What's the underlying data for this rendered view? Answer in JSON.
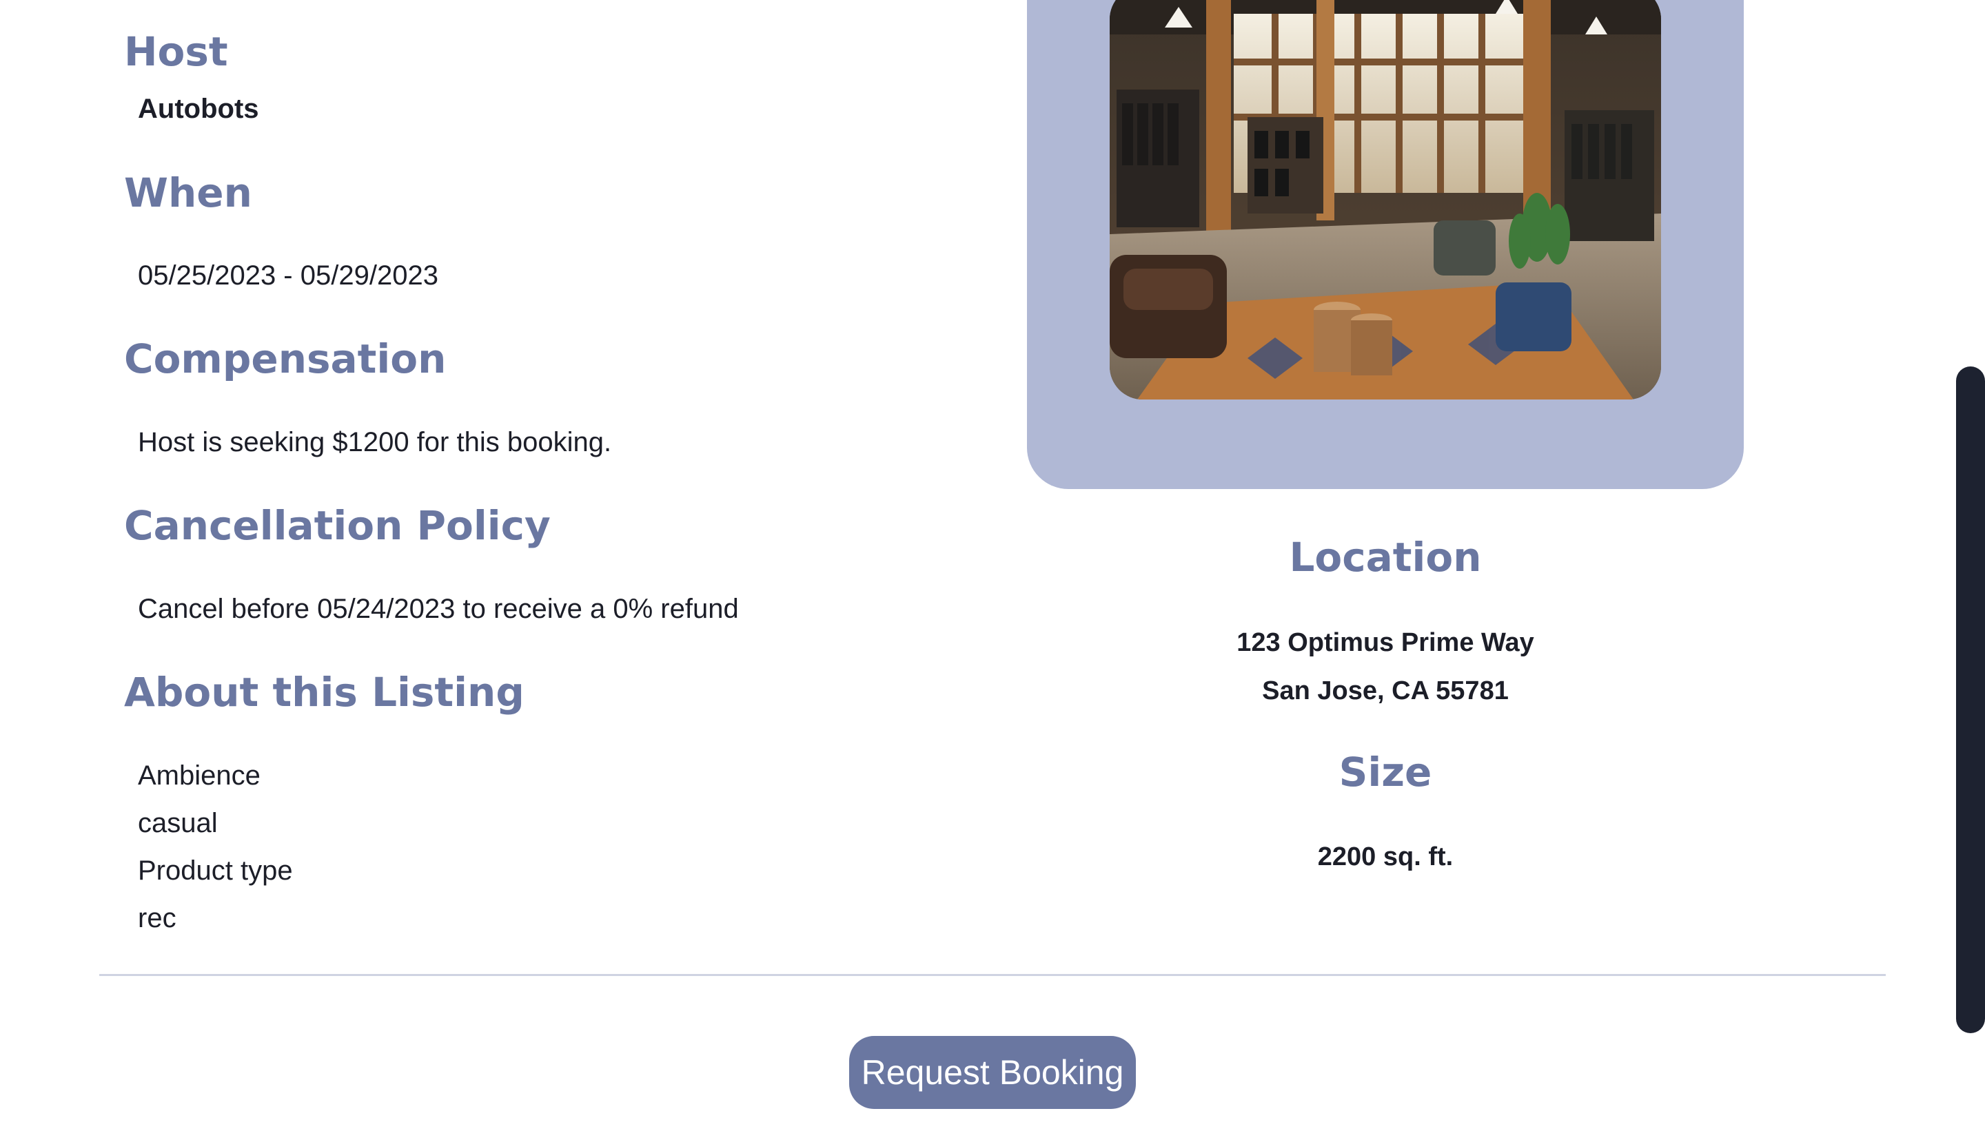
{
  "listing": {
    "host_heading": "Host",
    "host_name": "Autobots",
    "when_heading": "When",
    "dates": "05/25/2023 - 05/29/2023",
    "compensation_heading": "Compensation",
    "compensation_text": "Host is seeking $1200 for this booking.",
    "cancellation_heading": "Cancellation Policy",
    "cancellation_text": "Cancel before 05/24/2023 to receive a 0% refund",
    "about_heading": "About this Listing",
    "about_items": [
      "Ambience",
      "casual",
      "Product type",
      "rec"
    ]
  },
  "location": {
    "heading": "Location",
    "address_line1": "123 Optimus Prime Way",
    "address_line2": "San Jose, CA 55781"
  },
  "size": {
    "heading": "Size",
    "value": "2200 sq. ft."
  },
  "actions": {
    "request_booking_label": "Request Booking"
  },
  "colors": {
    "heading": "#6a77a1",
    "panel": "#b0b8d5",
    "button": "#6a77a1",
    "text": "#1c1e28"
  }
}
